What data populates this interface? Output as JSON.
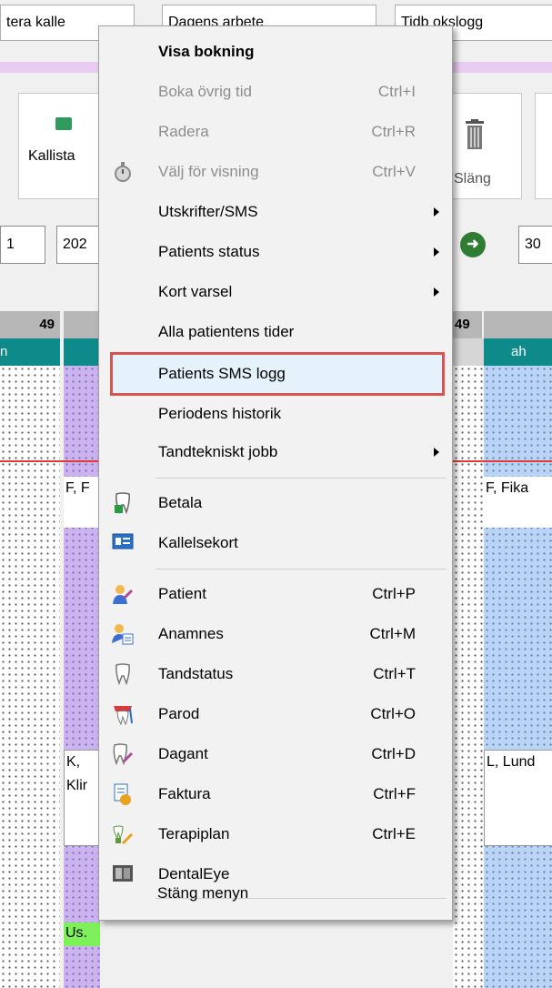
{
  "background": {
    "top_buttons": [
      "tera kalle",
      "Dagens arbete",
      "Tidb okslogg"
    ],
    "panel_labels": {
      "kallista": "Kallista",
      "slang": "Släng"
    },
    "date_inputs": {
      "left_number": "1",
      "date_prefix": "202",
      "right_prefix": "30"
    },
    "column_numbers": {
      "left": "49",
      "right": "49"
    },
    "teal_labels": {
      "left": "n",
      "right": "ah"
    },
    "grid_texts": {
      "f1": "F, F",
      "fika": "F, Fika",
      "k": "K,",
      "klir": "Klir",
      "lund": "L, Lund",
      "us": "Us."
    }
  },
  "menu": {
    "items": [
      {
        "label": "Visa bokning",
        "shortcut": "",
        "bold": true,
        "disabled": false,
        "submenu": false,
        "icon": ""
      },
      {
        "label": "Boka övrig tid",
        "shortcut": "Ctrl+I",
        "bold": false,
        "disabled": true,
        "submenu": false,
        "icon": ""
      },
      {
        "label": "Radera",
        "shortcut": "Ctrl+R",
        "bold": false,
        "disabled": true,
        "submenu": false,
        "icon": ""
      },
      {
        "label": "Välj för visning",
        "shortcut": "Ctrl+V",
        "bold": false,
        "disabled": true,
        "submenu": false,
        "icon": "stopwatch-icon"
      },
      {
        "label": "Utskrifter/SMS",
        "shortcut": "",
        "bold": false,
        "disabled": false,
        "submenu": true,
        "icon": ""
      },
      {
        "label": "Patients status",
        "shortcut": "",
        "bold": false,
        "disabled": false,
        "submenu": true,
        "icon": ""
      },
      {
        "label": "Kort varsel",
        "shortcut": "",
        "bold": false,
        "disabled": false,
        "submenu": true,
        "icon": ""
      },
      {
        "label": "Alla patientens tider",
        "shortcut": "",
        "bold": false,
        "disabled": false,
        "submenu": false,
        "icon": ""
      },
      {
        "label": "Patients SMS logg",
        "shortcut": "",
        "bold": false,
        "disabled": false,
        "submenu": false,
        "icon": ""
      },
      {
        "label": "Periodens historik",
        "shortcut": "",
        "bold": false,
        "disabled": false,
        "submenu": false,
        "icon": ""
      },
      {
        "label": "Tandtekniskt jobb",
        "shortcut": "",
        "bold": false,
        "disabled": false,
        "submenu": true,
        "icon": ""
      },
      {
        "label": "Betala",
        "shortcut": "",
        "bold": false,
        "disabled": false,
        "submenu": false,
        "icon": "tooth-payment-icon"
      },
      {
        "label": "Kallelsekort",
        "shortcut": "",
        "bold": false,
        "disabled": false,
        "submenu": false,
        "icon": "card-icon"
      },
      {
        "label": "Patient",
        "shortcut": "Ctrl+P",
        "bold": false,
        "disabled": false,
        "submenu": false,
        "icon": "patient-icon"
      },
      {
        "label": "Anamnes",
        "shortcut": "Ctrl+M",
        "bold": false,
        "disabled": false,
        "submenu": false,
        "icon": "anamnes-icon"
      },
      {
        "label": "Tandstatus",
        "shortcut": "Ctrl+T",
        "bold": false,
        "disabled": false,
        "submenu": false,
        "icon": "tooth-icon"
      },
      {
        "label": "Parod",
        "shortcut": "Ctrl+O",
        "bold": false,
        "disabled": false,
        "submenu": false,
        "icon": "parod-icon"
      },
      {
        "label": "Dagant",
        "shortcut": "Ctrl+D",
        "bold": false,
        "disabled": false,
        "submenu": false,
        "icon": "dagant-icon"
      },
      {
        "label": "Faktura",
        "shortcut": "Ctrl+F",
        "bold": false,
        "disabled": false,
        "submenu": false,
        "icon": "invoice-icon"
      },
      {
        "label": "Terapiplan",
        "shortcut": "Ctrl+E",
        "bold": false,
        "disabled": false,
        "submenu": false,
        "icon": "therapy-plan-icon"
      },
      {
        "label": "DentalEye",
        "shortcut": "",
        "bold": false,
        "disabled": false,
        "submenu": false,
        "icon": "dentaleye-icon"
      },
      {
        "label": "Stäng menyn",
        "shortcut": "",
        "bold": false,
        "disabled": false,
        "submenu": false,
        "icon": ""
      }
    ]
  },
  "colors": {
    "highlight_border": "#d9534f",
    "teal": "#0e8a8a",
    "purple": "#cbb3ef",
    "blue": "#b9d4f4"
  }
}
